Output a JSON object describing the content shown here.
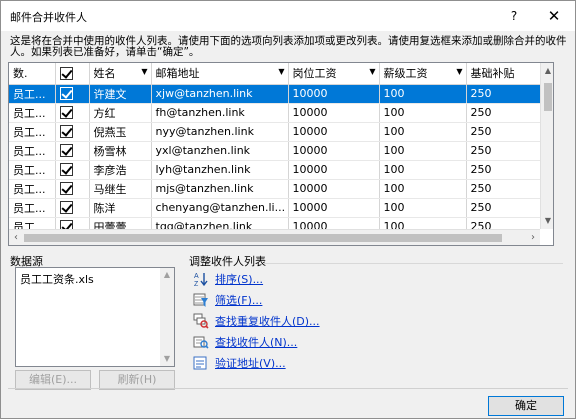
{
  "window": {
    "title": "邮件合并收件人",
    "help": "?",
    "close": "✕"
  },
  "description": "这是将在合并中使用的收件人列表。请使用下面的选项向列表添加项或更改列表。请使用复选框来添加或删除合并的收件人。如果列表已准备好，请单击“确定”。",
  "columns": [
    "数.",
    "",
    "姓名",
    "邮箱地址",
    "岗位工资",
    "薪级工资",
    "基础补贴",
    "扌"
  ],
  "rows": [
    {
      "src": "员工...",
      "checked": true,
      "name": "许建文",
      "email": "xjw@tanzhen.link",
      "post": "10000",
      "grade": "100",
      "base": "250",
      "selected": true
    },
    {
      "src": "员工...",
      "checked": true,
      "name": "方红",
      "email": "fh@tanzhen.link",
      "post": "10000",
      "grade": "100",
      "base": "250",
      "selected": false
    },
    {
      "src": "员工...",
      "checked": true,
      "name": "倪燕玉",
      "email": "nyy@tanzhen.link",
      "post": "10000",
      "grade": "100",
      "base": "250",
      "selected": false
    },
    {
      "src": "员工...",
      "checked": true,
      "name": "杨雪林",
      "email": "yxl@tanzhen.link",
      "post": "10000",
      "grade": "100",
      "base": "250",
      "selected": false
    },
    {
      "src": "员工...",
      "checked": true,
      "name": "李彦浩",
      "email": "lyh@tanzhen.link",
      "post": "10000",
      "grade": "100",
      "base": "250",
      "selected": false
    },
    {
      "src": "员工...",
      "checked": true,
      "name": "马继生",
      "email": "mjs@tanzhen.link",
      "post": "10000",
      "grade": "100",
      "base": "250",
      "selected": false
    },
    {
      "src": "员工...",
      "checked": true,
      "name": "陈洋",
      "email": "chenyang@tanzhen.li...",
      "post": "10000",
      "grade": "100",
      "base": "250",
      "selected": false
    },
    {
      "src": "员工...",
      "checked": true,
      "name": "田蕾蕾",
      "email": "tgq@tanzhen.link",
      "post": "10000",
      "grade": "100",
      "base": "250",
      "selected": false
    }
  ],
  "datasource": {
    "label": "数据源",
    "item": "员工工资条.xls",
    "edit": "编辑(E)...",
    "refresh": "刷新(H)"
  },
  "refine": {
    "label": "调整收件人列表",
    "actions": [
      {
        "label": "排序(S)...",
        "icon": "sort-icon"
      },
      {
        "label": "筛选(F)...",
        "icon": "filter-icon"
      },
      {
        "label": "查找重复收件人(D)...",
        "icon": "find-duplicates-icon"
      },
      {
        "label": "查找收件人(N)...",
        "icon": "find-recipient-icon"
      },
      {
        "label": "验证地址(V)...",
        "icon": "validate-address-icon"
      }
    ]
  },
  "ok": "确定",
  "colors": {
    "selection": "#0078d7",
    "link": "#0033cc"
  }
}
